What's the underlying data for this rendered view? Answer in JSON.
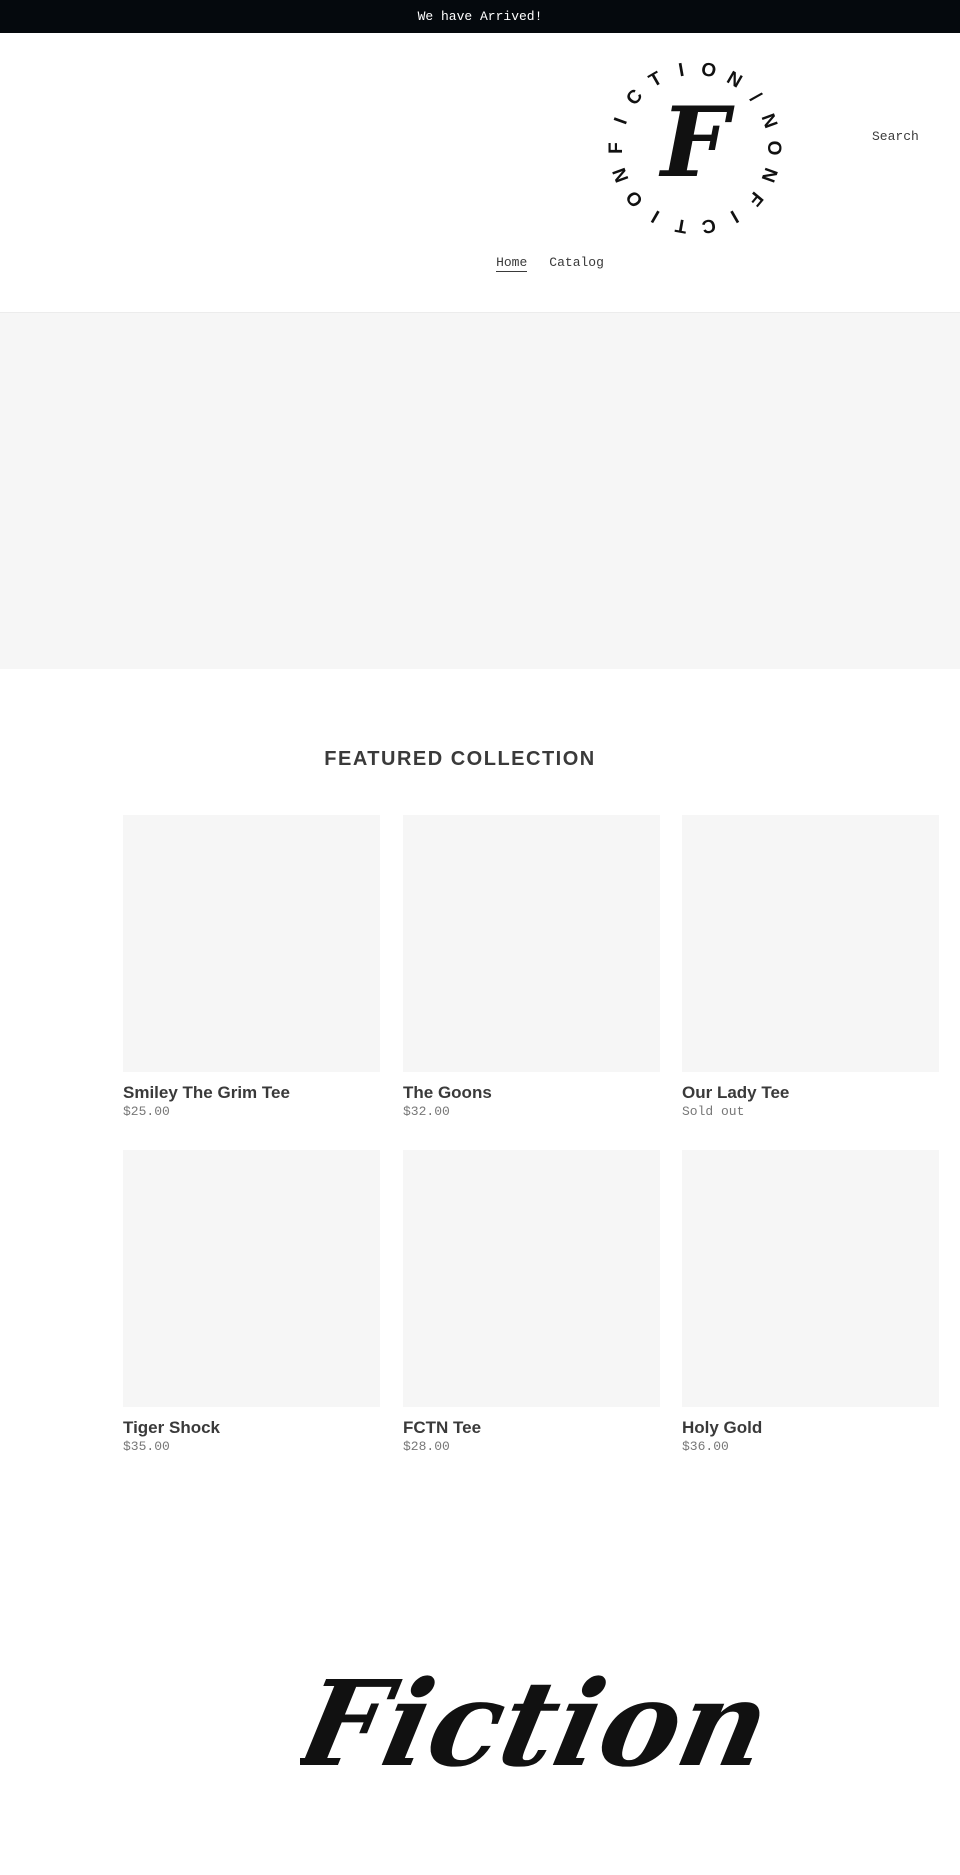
{
  "announcement": {
    "text": "We have Arrived!"
  },
  "header": {
    "logo": {
      "ring_text": "FICTION/NONFICTION",
      "monogram": "F",
      "icon": "fiction-logo-icon"
    },
    "search_label": "Search",
    "nav": [
      {
        "label": "Home",
        "active": true
      },
      {
        "label": "Catalog",
        "active": false
      }
    ]
  },
  "featured": {
    "title": "FEATURED COLLECTION",
    "products": [
      {
        "name": "Smiley The Grim Tee",
        "price": "$25.00"
      },
      {
        "name": "The Goons",
        "price": "$32.00"
      },
      {
        "name": "Our Lady Tee",
        "price": "Sold out"
      },
      {
        "name": "Tiger Shock",
        "price": "$35.00"
      },
      {
        "name": "FCTN Tee",
        "price": "$28.00"
      },
      {
        "name": "Holy Gold",
        "price": "$36.00"
      }
    ]
  },
  "footer_logo": {
    "text": "Fiction",
    "icon": "fiction-script-logo"
  },
  "colors": {
    "announcement_bg": "#05090d",
    "placeholder_bg": "#f6f6f6",
    "text": "#3a3a3a",
    "muted": "#777777"
  }
}
